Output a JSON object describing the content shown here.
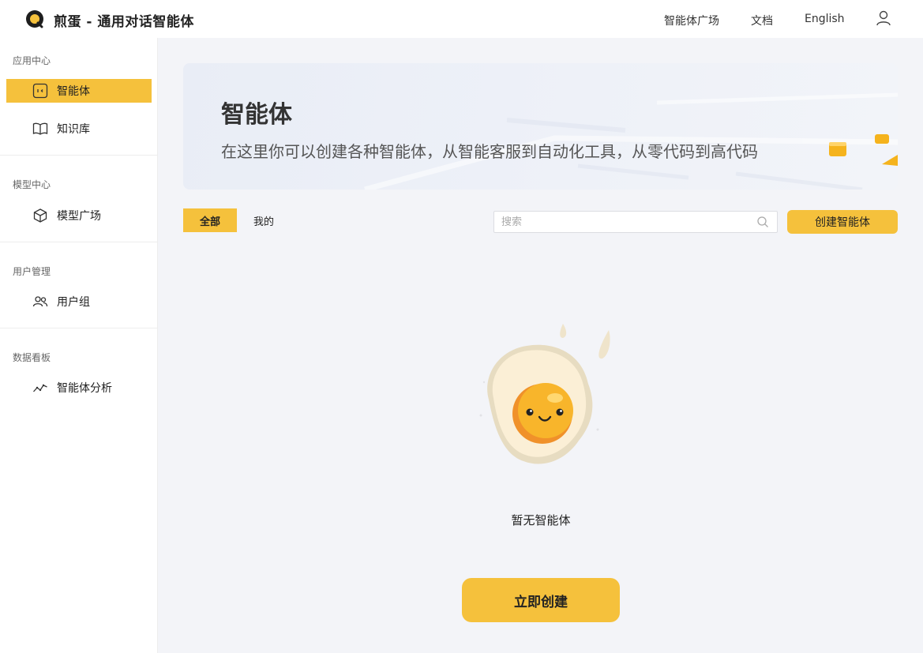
{
  "header": {
    "title": "煎蛋 - 通用对话智能体",
    "nav": [
      "智能体广场",
      "文档",
      "English"
    ],
    "logo_icon": "egg-logo-icon",
    "user_icon": "user-icon"
  },
  "sidebar": {
    "sections": [
      {
        "title": "应用中心",
        "items": [
          {
            "label": "智能体",
            "icon": "agent-icon",
            "active": true
          },
          {
            "label": "知识库",
            "icon": "book-icon"
          }
        ]
      },
      {
        "title": "模型中心",
        "items": [
          {
            "label": "模型广场",
            "icon": "cube-icon"
          }
        ]
      },
      {
        "title": "用户管理",
        "items": [
          {
            "label": "用户组",
            "icon": "users-icon"
          }
        ]
      },
      {
        "title": "数据看板",
        "items": [
          {
            "label": "智能体分析",
            "icon": "trend-icon"
          }
        ]
      }
    ]
  },
  "banner": {
    "title": "智能体",
    "subtitle": "在这里你可以创建各种智能体，从智能客服到自动化工具，从零代码到高代码"
  },
  "tabs": [
    {
      "label": "全部",
      "active": true
    },
    {
      "label": "我的"
    }
  ],
  "search": {
    "placeholder": "搜索",
    "value": ""
  },
  "actions": {
    "create_label": "创建智能体"
  },
  "empty": {
    "text": "暂无智能体",
    "button_label": "立即创建"
  },
  "colors": {
    "accent": "#f5c13c",
    "background": "#f3f4f8"
  }
}
